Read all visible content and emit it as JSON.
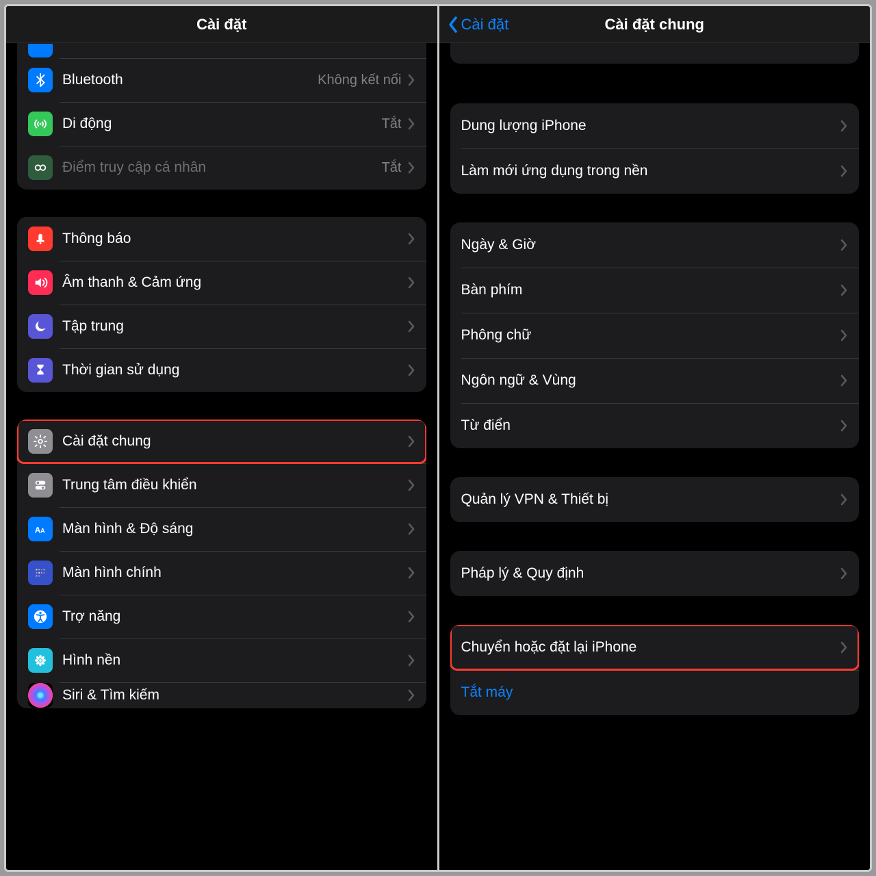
{
  "left": {
    "title": "Cài đặt",
    "groups": [
      {
        "partial_top": true,
        "rows": [
          {
            "icon": "cut",
            "color": "#007aff",
            "label": ""
          },
          {
            "icon": "bluetooth",
            "color": "#007aff",
            "label": "Bluetooth",
            "value": "Không kết nối"
          },
          {
            "icon": "cellular",
            "color": "#34c759",
            "label": "Di động",
            "value": "Tắt"
          },
          {
            "icon": "hotspot",
            "color": "#34c759",
            "label": "Điểm truy cập cá nhân",
            "value": "Tắt",
            "disabled": true
          }
        ]
      },
      {
        "rows": [
          {
            "icon": "bell",
            "color": "#ff3b30",
            "label": "Thông báo"
          },
          {
            "icon": "sound",
            "color": "#ff2d55",
            "label": "Âm thanh & Cảm ứng"
          },
          {
            "icon": "moon",
            "color": "#5856d6",
            "label": "Tập trung"
          },
          {
            "icon": "hourglass",
            "color": "#5856d6",
            "label": "Thời gian sử dụng"
          }
        ]
      },
      {
        "rows": [
          {
            "icon": "gear",
            "color": "#8e8e93",
            "label": "Cài đặt chung",
            "highlight": true
          },
          {
            "icon": "switches",
            "color": "#8e8e93",
            "label": "Trung tâm điều khiển"
          },
          {
            "icon": "aa",
            "color": "#007aff",
            "label": "Màn hình & Độ sáng"
          },
          {
            "icon": "grid",
            "color": "#3651c9",
            "label": "Màn hình chính"
          },
          {
            "icon": "accessibility",
            "color": "#007aff",
            "label": "Trợ năng"
          },
          {
            "icon": "flower",
            "color": "#23c0de",
            "label": "Hình nền"
          },
          {
            "icon": "siri",
            "color": "#000",
            "label": "Siri & Tìm kiếm",
            "cut_bottom": true
          }
        ]
      }
    ]
  },
  "right": {
    "back_label": "Cài đặt",
    "title": "Cài đặt chung",
    "groups": [
      {
        "partial_top": true,
        "rows": [
          {
            "label": ""
          }
        ]
      },
      {
        "rows": [
          {
            "label": "Dung lượng iPhone"
          },
          {
            "label": "Làm mới ứng dụng trong nền"
          }
        ]
      },
      {
        "rows": [
          {
            "label": "Ngày & Giờ"
          },
          {
            "label": "Bàn phím"
          },
          {
            "label": "Phông chữ"
          },
          {
            "label": "Ngôn ngữ & Vùng"
          },
          {
            "label": "Từ điển"
          }
        ]
      },
      {
        "rows": [
          {
            "label": "Quản lý VPN & Thiết bị"
          }
        ]
      },
      {
        "rows": [
          {
            "label": "Pháp lý & Quy định"
          }
        ]
      },
      {
        "rows": [
          {
            "label": "Chuyển hoặc đặt lại iPhone",
            "highlight": true
          },
          {
            "label": "Tắt máy",
            "link": true,
            "no_chevron": true
          }
        ]
      }
    ]
  }
}
